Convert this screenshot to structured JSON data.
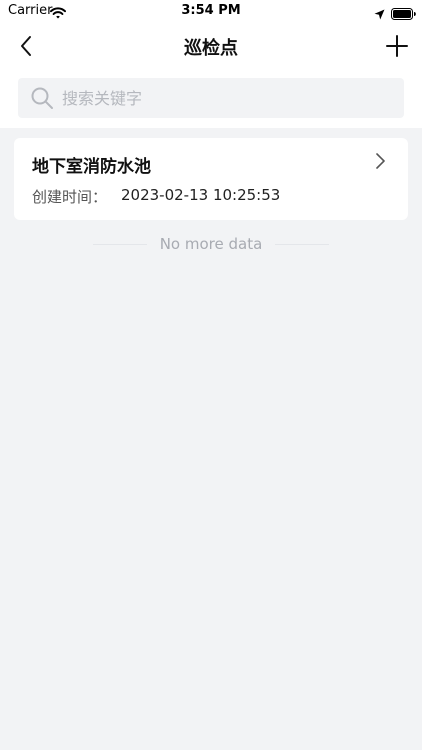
{
  "status_bar": {
    "carrier": "Carrier",
    "time": "3:54 PM"
  },
  "nav": {
    "title": "巡检点"
  },
  "search": {
    "placeholder": "搜索关键字",
    "value": ""
  },
  "items": [
    {
      "title": "地下室消防水池",
      "created_label": "创建时间：",
      "created_value": "2023-02-13 10:25:53"
    }
  ],
  "list_footer": "No more data",
  "icons": {
    "back": "chevron-left-icon",
    "add": "plus-icon",
    "search": "search-icon",
    "item_arrow": "chevron-right-icon",
    "wifi": "wifi-icon",
    "location": "location-arrow-icon",
    "battery": "battery-icon"
  },
  "colors": {
    "background": "#f2f3f5",
    "card": "#ffffff",
    "title_text": "#111111",
    "placeholder": "#b5b8be",
    "footer_text": "#a8abb2"
  }
}
